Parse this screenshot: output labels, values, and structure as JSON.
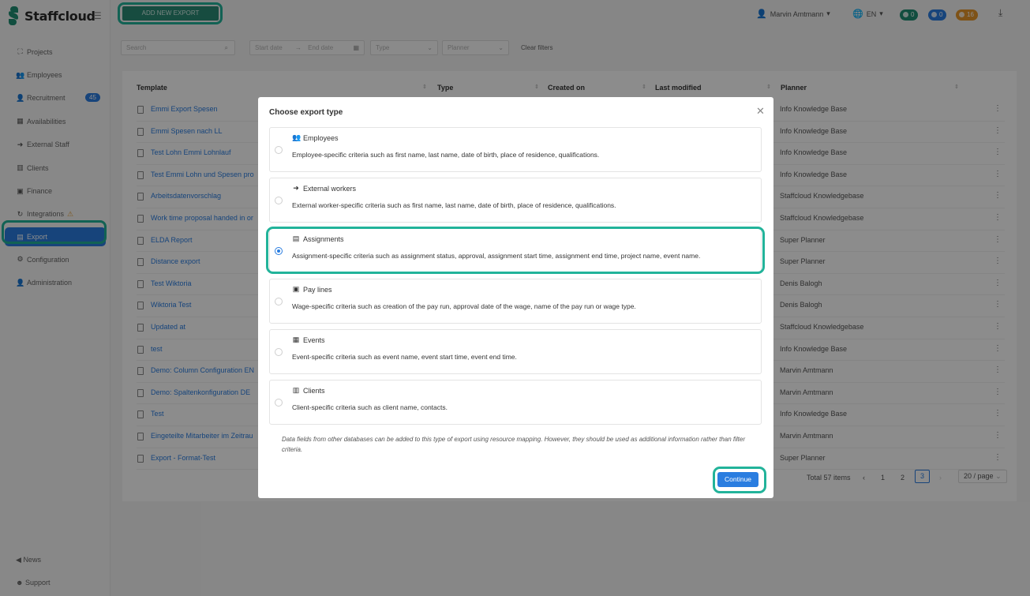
{
  "app": {
    "logo_text": "Staffcloud"
  },
  "sidebar": {
    "items": [
      {
        "label": "Projects",
        "icon": "sitemap-icon",
        "glyph": "⛶"
      },
      {
        "label": "Employees",
        "icon": "users-icon",
        "glyph": "👥"
      },
      {
        "label": "Recruitment",
        "icon": "user-plus-icon",
        "glyph": "👤"
      },
      {
        "label": "Availabilities",
        "icon": "calendar-icon",
        "glyph": "▦"
      },
      {
        "label": "External Staff",
        "icon": "sign-in-icon",
        "glyph": "➜"
      },
      {
        "label": "Clients",
        "icon": "building-icon",
        "glyph": "▥"
      },
      {
        "label": "Finance",
        "icon": "money-icon",
        "glyph": "▣"
      },
      {
        "label": "Integrations",
        "icon": "sync-icon",
        "glyph": "↻"
      },
      {
        "label": "Export",
        "icon": "file-icon",
        "glyph": "▤"
      },
      {
        "label": "Configuration",
        "icon": "gear-icon",
        "glyph": "⚙"
      },
      {
        "label": "Administration",
        "icon": "user-cog-icon",
        "glyph": "👤"
      }
    ],
    "recruitment_badge": "45",
    "bottom": [
      {
        "label": "News",
        "icon": "megaphone-icon"
      },
      {
        "label": "Support",
        "icon": "support-icon"
      }
    ]
  },
  "topbar": {
    "add_button": "ADD NEW EXPORT",
    "user_name": "Marvin Amtmann",
    "language": "EN",
    "badges": [
      {
        "count": "0",
        "color": "#1f8f73"
      },
      {
        "count": "0",
        "color": "#2a7de0"
      },
      {
        "count": "16",
        "color": "#e6962b"
      }
    ]
  },
  "filters": {
    "search_placeholder": "Search",
    "start_date": "Start date",
    "end_date": "End date",
    "type": "Type",
    "planner": "Planner",
    "clear": "Clear filters"
  },
  "table": {
    "columns": [
      "Template",
      "Type",
      "Created on",
      "Last modified",
      "Planner"
    ],
    "rows": [
      {
        "template": "Emmi Export Spesen",
        "planner": "Info Knowledge Base"
      },
      {
        "template": "Emmi Spesen nach LL",
        "planner": "Info Knowledge Base"
      },
      {
        "template": "Test Lohn Emmi Lohnlauf",
        "planner": "Info Knowledge Base"
      },
      {
        "template": "Test Emmi Lohn und Spesen pro",
        "planner": "Info Knowledge Base"
      },
      {
        "template": "Arbeitsdatenvorschlag",
        "planner": "Staffcloud Knowledgebase"
      },
      {
        "template": "Work time proposal handed in or",
        "planner": "Staffcloud Knowledgebase"
      },
      {
        "template": "ELDA Report",
        "planner": "Super Planner"
      },
      {
        "template": "Distance export",
        "planner": "Super Planner"
      },
      {
        "template": "Test Wiktoria",
        "planner": "Denis Balogh"
      },
      {
        "template": "Wiktoria Test",
        "planner": "Denis Balogh"
      },
      {
        "template": "Updated at",
        "planner": "Staffcloud Knowledgebase"
      },
      {
        "template": "test",
        "planner": "Info Knowledge Base"
      },
      {
        "template": "Demo: Column Configuration EN",
        "planner": "Marvin Amtmann"
      },
      {
        "template": "Demo: Spaltenkonfiguration DE",
        "planner": "Marvin Amtmann"
      },
      {
        "template": "Test",
        "planner": "Info Knowledge Base"
      },
      {
        "template": "Eingeteilte Mitarbeiter im Zeitrau",
        "planner": "Marvin Amtmann"
      },
      {
        "template": "Export - Format-Test",
        "planner": "Super Planner"
      }
    ],
    "total": "Total 57 items",
    "pages": [
      "1",
      "2",
      "3"
    ],
    "current_page": "3",
    "page_size": "20 / page"
  },
  "modal": {
    "title": "Choose export type",
    "options": [
      {
        "title": "Employees",
        "icon": "users-icon",
        "glyph": "👥",
        "desc": "Employee-specific criteria such as first name, last name, date of birth, place of residence, qualifications.",
        "selected": false
      },
      {
        "title": "External workers",
        "icon": "sign-in-icon",
        "glyph": "➜",
        "desc": "External worker-specific criteria such as first name, last name, date of birth, place of residence, qualifications.",
        "selected": false
      },
      {
        "title": "Assignments",
        "icon": "file-icon",
        "glyph": "▤",
        "desc": "Assignment-specific criteria such as assignment status, approval, assignment start time, assignment end time, project name, event name.",
        "selected": true
      },
      {
        "title": "Pay lines",
        "icon": "money-icon",
        "glyph": "▣",
        "desc": "Wage-specific criteria such as creation of the pay run, approval date of the wage, name of the pay run or wage type.",
        "selected": false
      },
      {
        "title": "Events",
        "icon": "calendar-icon",
        "glyph": "▦",
        "desc": "Event-specific criteria such as event name, event start time, event end time.",
        "selected": false
      },
      {
        "title": "Clients",
        "icon": "building-icon",
        "glyph": "▥",
        "desc": "Client-specific criteria such as client name, contacts.",
        "selected": false
      }
    ],
    "note": "Data fields from other databases can be added to this type of export using resource mapping. However, they should be used as additional information rather than filter criteria.",
    "continue": "Continue"
  }
}
